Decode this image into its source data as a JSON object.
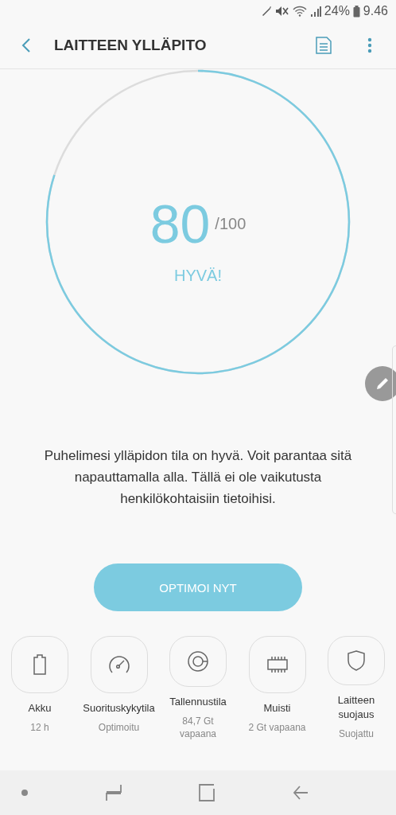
{
  "status_bar": {
    "battery": "24%",
    "time": "9.46"
  },
  "app_bar": {
    "title": "LAITTEEN YLLÄPITO"
  },
  "score": {
    "value": "80",
    "max": "/100",
    "rating": "HYVÄ!"
  },
  "description": "Puhelimesi ylläpidon tila on hyvä. Voit parantaa sitä napauttamalla alla. Tällä ei ole vaikutusta henkilökohtaisiin tietoihisi.",
  "optimize_button": "OPTIMOI NYT",
  "tiles": [
    {
      "kind": "battery",
      "label": "Akku",
      "detail": "12 h"
    },
    {
      "kind": "speed",
      "label": "Suorituskykytila",
      "detail": "Optimoitu"
    },
    {
      "kind": "storage",
      "label": "Tallennustila",
      "detail": "84,7 Gt vapaana"
    },
    {
      "kind": "memory",
      "label": "Muisti",
      "detail": "2 Gt vapaana"
    },
    {
      "kind": "security",
      "label": "Laitteen suojaus",
      "detail": "Suojattu"
    }
  ]
}
